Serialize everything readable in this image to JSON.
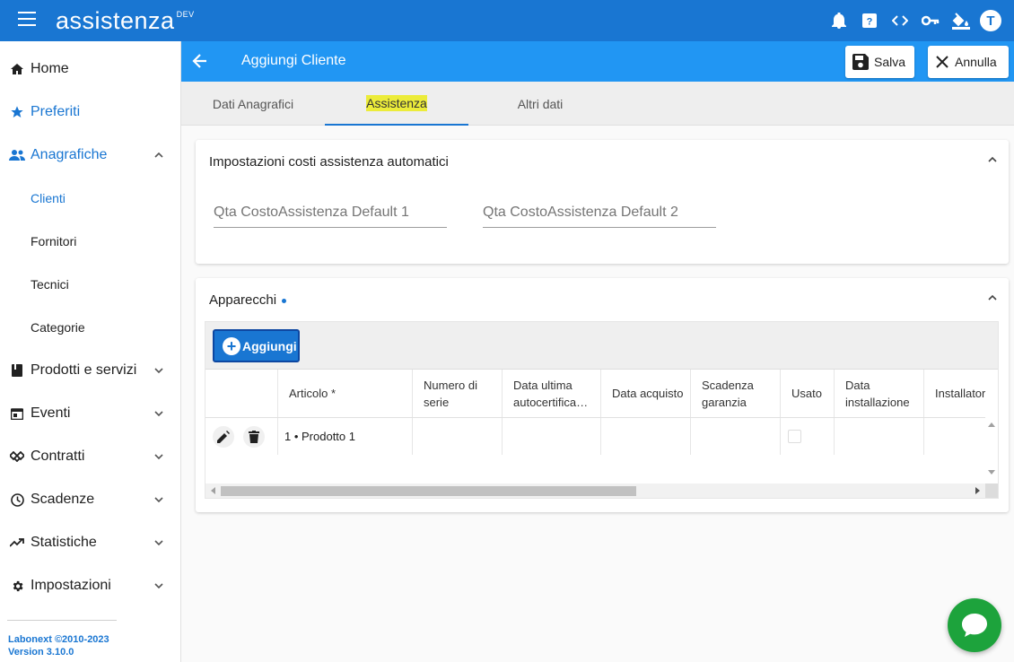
{
  "app": {
    "logo_text": "assistenza",
    "logo_badge": "DEV",
    "user_initial": "T"
  },
  "sidebar": {
    "items": [
      {
        "label": "Home",
        "icon": "home-icon"
      },
      {
        "label": "Preferiti",
        "icon": "star-icon"
      },
      {
        "label": "Anagrafiche",
        "icon": "people-icon",
        "expanded": true
      },
      {
        "label": "Clienti",
        "sub": true,
        "active": true
      },
      {
        "label": "Fornitori",
        "sub": true
      },
      {
        "label": "Tecnici",
        "sub": true
      },
      {
        "label": "Categorie",
        "sub": true
      },
      {
        "label": "Prodotti e servizi",
        "icon": "book-icon"
      },
      {
        "label": "Eventi",
        "icon": "calendar-icon"
      },
      {
        "label": "Contratti",
        "icon": "handshake-icon"
      },
      {
        "label": "Scadenze",
        "icon": "clock-icon"
      },
      {
        "label": "Statistiche",
        "icon": "trending-icon"
      },
      {
        "label": "Impostazioni",
        "icon": "gear-icon"
      }
    ],
    "footer_line1": "Labonext ©2010-2023",
    "footer_line2": "Version 3.10.0"
  },
  "header": {
    "title": "Aggiungi Cliente",
    "save_label": "Salva",
    "cancel_label": "Annulla"
  },
  "tabs": [
    {
      "label": "Dati Anagrafici"
    },
    {
      "label": "Assistenza",
      "active": true
    },
    {
      "label": "Altri dati"
    }
  ],
  "costs_card": {
    "title": "Impostazioni costi assistenza automatici",
    "field1_placeholder": "Qta CostoAssistenza Default 1",
    "field2_placeholder": "Qta CostoAssistenza Default 2"
  },
  "devices_card": {
    "title": "Apparecchi",
    "add_label": "Aggiungi",
    "columns": [
      "Articolo *",
      "Numero di serie",
      "Data ultima autocertifica…",
      "Data acquisto",
      "Scadenza garanzia",
      "Usato",
      "Data installazione",
      "Installator"
    ],
    "rows": [
      {
        "articolo": "1 • Prodotto 1",
        "numero_serie": "",
        "data_ultima": "",
        "data_acquisto": "",
        "scadenza": "",
        "data_installazione": "",
        "installatore": ""
      }
    ]
  },
  "colors": {
    "primary": "#1976d2",
    "header": "#2196f3",
    "highlight": "#ecec3a",
    "chat": "#1da33c"
  }
}
